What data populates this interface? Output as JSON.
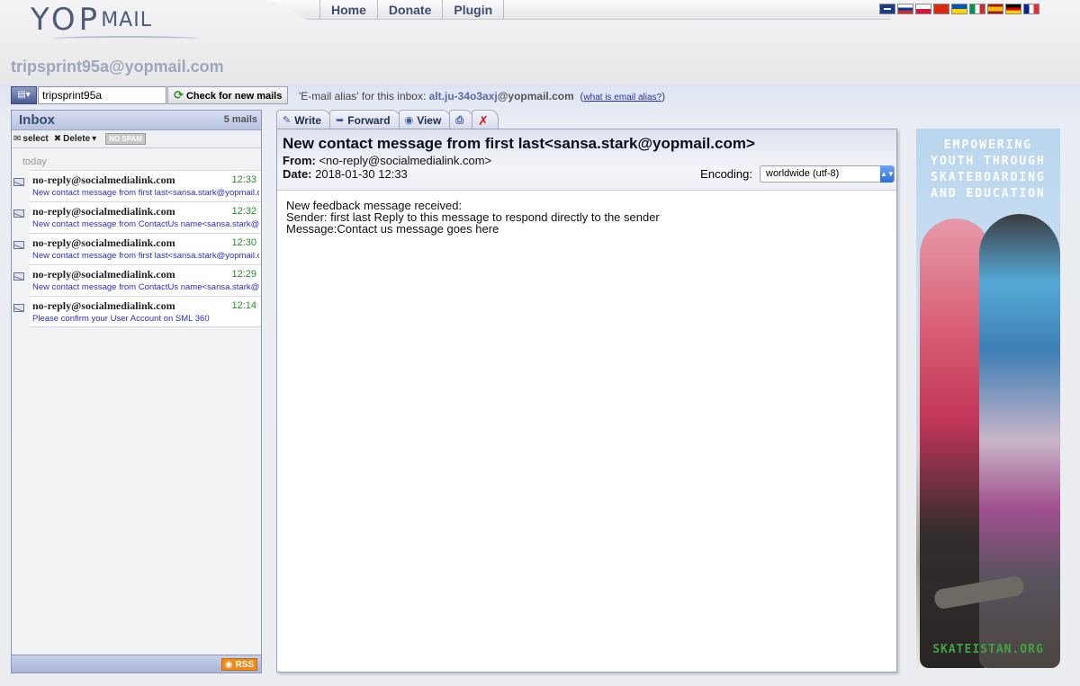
{
  "logo": {
    "text_main": "YOP",
    "text_mail": "MAIL"
  },
  "nav": {
    "items": [
      "Home",
      "Donate",
      "Plugin"
    ]
  },
  "flags": [
    {
      "name": "uk-flag",
      "color": "#1a3a8e"
    },
    {
      "name": "russia-flag",
      "color": "#d52b1e"
    },
    {
      "name": "poland-flag",
      "color": "#dc143c"
    },
    {
      "name": "china-flag",
      "color": "#de2910"
    },
    {
      "name": "ukraine-flag",
      "color": "#ffd500"
    },
    {
      "name": "italy-flag",
      "color": "#009246"
    },
    {
      "name": "spain-flag",
      "color": "#f1bf00"
    },
    {
      "name": "germany-flag",
      "color": "#dd0000"
    },
    {
      "name": "france-flag",
      "color": "#002395"
    }
  ],
  "inbox_address": "tripsprint95a@yopmail.com",
  "login": {
    "value": "tripsprint95a",
    "check_label": "Check for new mails",
    "alias_label": "'E-mail alias' for this inbox:",
    "alias_name": "alt.ju-34o3axj",
    "alias_domain": "@yopmail.com",
    "alias_help": "what is email alias?"
  },
  "inbox": {
    "title": "Inbox",
    "count": "5 mails",
    "tools": {
      "select": "select",
      "delete": "Delete",
      "nospam": "NO SPAM"
    },
    "group": "today",
    "mails": [
      {
        "from": "no-reply@socialmedialink.com",
        "time": "12:33",
        "subject": "New contact message from first last<sansa.stark@yopmail.com>"
      },
      {
        "from": "no-reply@socialmedialink.com",
        "time": "12:32",
        "subject": "New contact message from ContactUs name<sansa.stark@yopmail.com>"
      },
      {
        "from": "no-reply@socialmedialink.com",
        "time": "12:30",
        "subject": "New contact message from first last<sansa.stark@yopmail.com>"
      },
      {
        "from": "no-reply@socialmedialink.com",
        "time": "12:29",
        "subject": "New contact message from ContactUs name<sansa.stark@yopmail.com>"
      },
      {
        "from": "no-reply@socialmedialink.com",
        "time": "12:14",
        "subject": "Please confirm your User Account on SML 360"
      }
    ],
    "rss": "RSS"
  },
  "tabs": {
    "write": "Write",
    "forward": "Forward",
    "view": "View"
  },
  "message": {
    "subject": "New contact message from first last<sansa.stark@yopmail.com>",
    "from_label": "From:",
    "from_value": "<no-reply@socialmedialink.com>",
    "date_label": "Date:",
    "date_value": "2018-01-30 12:33",
    "encoding_label": "Encoding:",
    "encoding_value": "worldwide (utf-8)",
    "body": [
      "New feedback message received:",
      "Sender: first last Reply to this message to respond directly to the sender",
      "Message:Contact us message goes here"
    ]
  },
  "ad": {
    "headline": [
      "EMPOWERING",
      "YOUTH THROUGH",
      "SKATEBOARDING",
      "AND EDUCATION"
    ],
    "footer": "SKATEISTAN.ORG"
  }
}
